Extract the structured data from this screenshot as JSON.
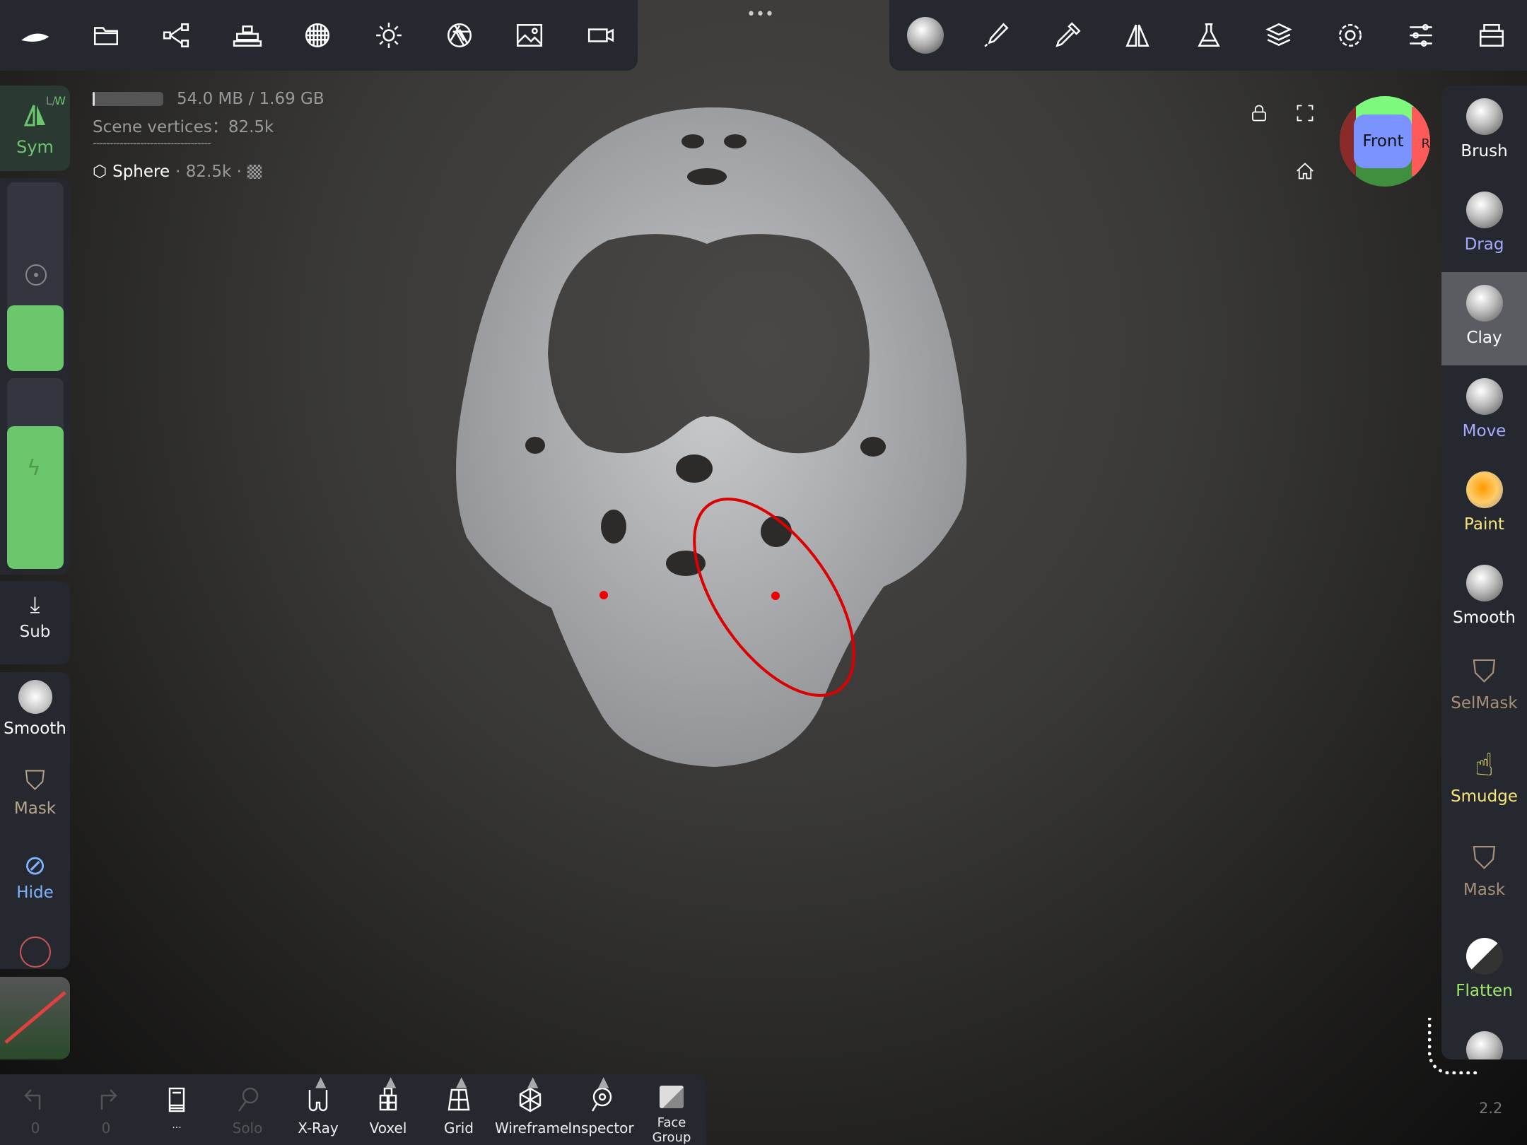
{
  "top_left_toolbar": {
    "icons": [
      "logo-icon",
      "folder-icon",
      "share-nodes-icon",
      "scene-hierarchy-icon",
      "topology-icon",
      "light-icon",
      "aperture-icon",
      "image-icon",
      "video-camera-icon"
    ]
  },
  "top_right_toolbar": {
    "icons": [
      "material-icon",
      "paint-brush-icon",
      "dropper-icon",
      "symmetry-icon",
      "flask-icon",
      "layers-icon",
      "settings-icon",
      "sliders-icon",
      "gallery-icon"
    ]
  },
  "more_dots": "•••",
  "info": {
    "memory": "54.0 MB / 1.69 GB",
    "memory_fraction": 0.03,
    "vertices": "Scene vertices：82.5k",
    "separator": "-----------------------------------",
    "object_name": "Sphere",
    "object_vertices": "· 82.5k ·"
  },
  "gizmo": {
    "front_label": "Front",
    "right_label": "R",
    "colors": {
      "front": "#7b93ff",
      "top": "#7dfa7d",
      "right": "#ff5a5a",
      "left": "#8a2a2a",
      "bottom": "#3f8f3f"
    }
  },
  "left_panel": {
    "sym_label": "Sym",
    "sym_mode_l": "L/",
    "sym_mode_w": "W",
    "sub_label": "Sub",
    "tools": [
      {
        "label": "Smooth",
        "color": "#ffffff"
      },
      {
        "label": "Mask",
        "color": "#b7a58c"
      },
      {
        "label": "Hide",
        "color": "#7fb3ff"
      }
    ],
    "radius_fraction": 0.35,
    "intensity_fraction": 0.75,
    "accent": "#6cc66c"
  },
  "right_panel": {
    "tools": [
      {
        "label": "Brush",
        "color": "#ffffff"
      },
      {
        "label": "Drag",
        "color": "#a7a9ff"
      },
      {
        "label": "Clay",
        "color": "#ffffff",
        "selected": true
      },
      {
        "label": "Move",
        "color": "#a7a9ff"
      },
      {
        "label": "Paint",
        "color": "#f6e57a"
      },
      {
        "label": "Smooth",
        "color": "#ffffff"
      },
      {
        "label": "SelMask",
        "color": "#a78f78"
      },
      {
        "label": "Smudge",
        "color": "#f6e57a"
      },
      {
        "label": "Mask",
        "color": "#a78f78"
      },
      {
        "label": "Flatten",
        "color": "#9ee86b"
      }
    ]
  },
  "bottom_bar": {
    "undo_count": "0",
    "redo_count": "0",
    "more_label": "...",
    "solo": "Solo",
    "xray": "X-Ray",
    "voxel": "Voxel",
    "grid": "Grid",
    "wireframe": "Wireframe",
    "inspector": "Inspector",
    "face_group": "Face Group"
  },
  "version": "2.2"
}
